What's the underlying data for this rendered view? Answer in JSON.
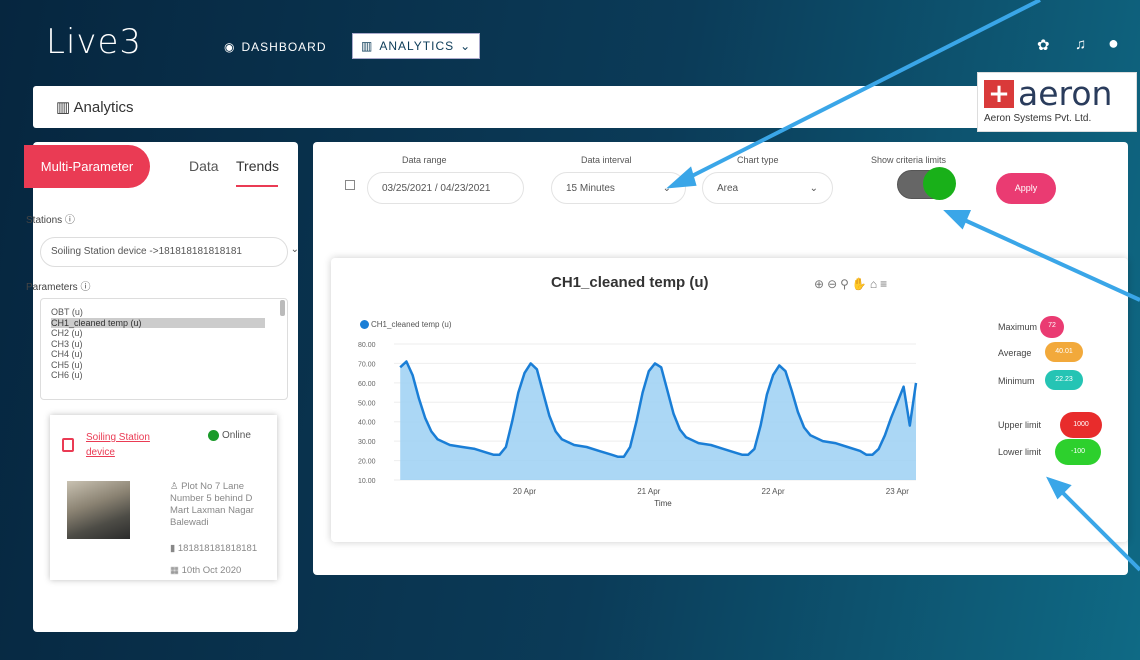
{
  "topbar": {
    "logo": "Live3",
    "nav_dashboard": "DASHBOARD",
    "nav_analytics": "ANALYTICS",
    "icons": [
      "gear-icon",
      "bell-icon",
      "user-icon"
    ]
  },
  "header": {
    "title": "Analytics"
  },
  "brand": {
    "name": "aeron",
    "subtitle": "Aeron Systems Pvt. Ltd."
  },
  "sidebar": {
    "tab_multi": "Multi-Parameter",
    "tab_data": "Data",
    "tab_trends": "Trends",
    "stations_label": "Stations ⓘ",
    "station_value": "Soiling Station device ->181818181818181",
    "parameters_label": "Parameters ⓘ",
    "parameters": [
      "OBT (u)",
      "CH1_cleaned temp (u)",
      "CH2 (u)",
      "CH3 (u)",
      "CH4 (u)",
      "CH5 (u)",
      "CH6 (u)"
    ],
    "selected_parameter": "CH1_cleaned temp (u)",
    "station": {
      "name": "Soiling Station device",
      "status": "Online",
      "address": "Plot No 7 Lane Number 5 behind D Mart Laxman Nagar Balewadi",
      "device_id": "181818181818181",
      "date": "10th Oct 2020"
    }
  },
  "filters": {
    "date_range_label": "Data range",
    "date_range_value": "03/25/2021 / 04/23/2021",
    "interval_label": "Data interval",
    "interval_value": "15 Minutes",
    "chart_type_label": "Chart type",
    "chart_type_value": "Area",
    "criteria_label": "Show criteria limits",
    "criteria_on": true,
    "apply_label": "Apply"
  },
  "stats": {
    "max_label": "Maximum",
    "max_value": "72",
    "avg_label": "Average",
    "avg_value": "40.01",
    "min_label": "Minimum",
    "min_value": "22.23",
    "upper_label": "Upper limit",
    "upper_value": "1000",
    "lower_label": "Lower limit",
    "lower_value": "-100"
  },
  "chart_data": {
    "type": "area",
    "title": "CH1_cleaned temp (u)",
    "xlabel": "Time",
    "ylabel": "",
    "series": [
      {
        "name": "CH1_cleaned temp (u)"
      }
    ],
    "color": "#1a7ed6",
    "ylim": [
      10,
      80
    ],
    "y_ticks": [
      "80.00",
      "70.00",
      "60.00",
      "50.00",
      "40.00",
      "30.00",
      "20.00",
      "10.00"
    ],
    "x_ticks": [
      "20 Apr",
      "21 Apr",
      "22 Apr",
      "23 Apr"
    ],
    "x_tick_pos": [
      1.0,
      2.0,
      3.0,
      4.0
    ],
    "xlim": [
      -0.05,
      4.15
    ],
    "x": [
      0.0,
      0.05,
      0.1,
      0.15,
      0.2,
      0.25,
      0.3,
      0.4,
      0.5,
      0.6,
      0.7,
      0.75,
      0.8,
      0.85,
      0.9,
      0.95,
      1.0,
      1.05,
      1.1,
      1.15,
      1.2,
      1.25,
      1.3,
      1.4,
      1.5,
      1.6,
      1.7,
      1.75,
      1.8,
      1.85,
      1.9,
      1.95,
      2.0,
      2.05,
      2.1,
      2.15,
      2.2,
      2.25,
      2.3,
      2.4,
      2.5,
      2.6,
      2.7,
      2.75,
      2.8,
      2.85,
      2.9,
      2.95,
      3.0,
      3.05,
      3.1,
      3.15,
      3.2,
      3.25,
      3.3,
      3.4,
      3.5,
      3.6,
      3.7,
      3.75,
      3.8,
      3.85,
      3.9,
      3.95,
      4.0,
      4.05,
      4.1,
      4.15
    ],
    "y": [
      68,
      71,
      64,
      52,
      42,
      35,
      31,
      28,
      27,
      26,
      24,
      23,
      23,
      27,
      40,
      55,
      65,
      70,
      67,
      55,
      43,
      35,
      31,
      28,
      27,
      25,
      23,
      22,
      22,
      27,
      40,
      55,
      66,
      70,
      68,
      56,
      44,
      36,
      32,
      29,
      28,
      26,
      24,
      23,
      23,
      26,
      38,
      54,
      64,
      69,
      66,
      56,
      45,
      37,
      33,
      30,
      29,
      27,
      25,
      23,
      23,
      26,
      33,
      42,
      50,
      58,
      38,
      60
    ]
  }
}
